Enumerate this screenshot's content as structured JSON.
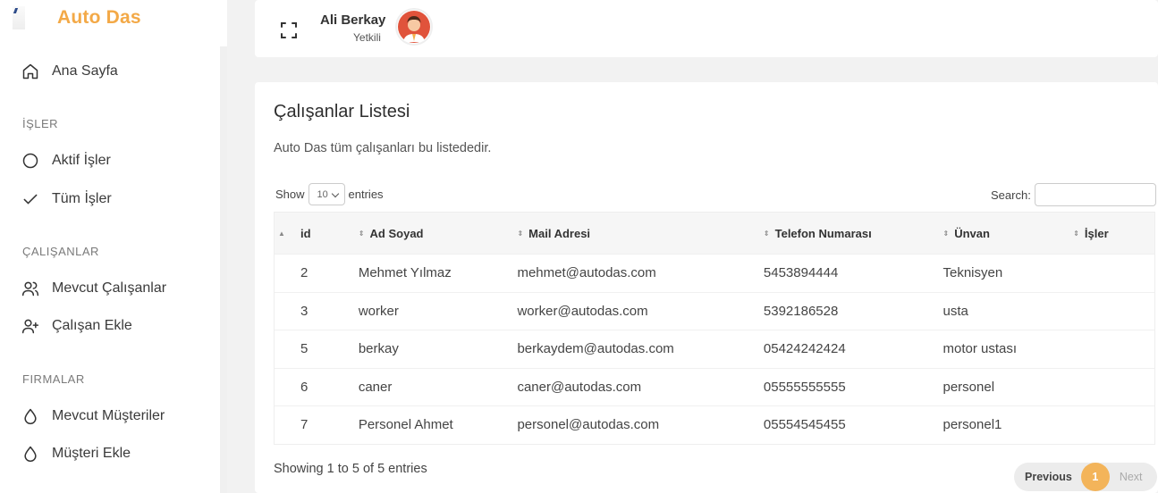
{
  "app": {
    "title": "Auto Das"
  },
  "sidebar": {
    "items": [
      {
        "label": "Ana Sayfa",
        "icon": "home-icon"
      },
      {
        "label": "Aktif İşler",
        "icon": "circle-icon"
      },
      {
        "label": "Tüm İşler",
        "icon": "check-icon"
      },
      {
        "label": "Mevcut Çalışanlar",
        "icon": "users-icon"
      },
      {
        "label": "Çalışan Ekle",
        "icon": "user-plus-icon"
      },
      {
        "label": "Mevcut Müşteriler",
        "icon": "droplet-icon"
      },
      {
        "label": "Müşteri Ekle",
        "icon": "droplet-icon"
      }
    ],
    "sections": [
      "İŞLER",
      "ÇALIŞANLAR",
      "FIRMALAR"
    ]
  },
  "topbar": {
    "user_name": "Ali Berkay",
    "user_role": "Yetkili"
  },
  "card": {
    "title": "Çalışanlar Listesi",
    "description": "Auto Das tüm çalışanları bu listededir."
  },
  "table_controls": {
    "show_label": "Show",
    "page_size": "10",
    "entries_label": "entries",
    "search_label": "Search:"
  },
  "table": {
    "columns": [
      "id",
      "Ad Soyad",
      "Mail Adresi",
      "Telefon Numarası",
      "Ünvan",
      "İşler"
    ],
    "rows": [
      [
        "2",
        "Mehmet Yılmaz",
        "mehmet@autodas.com",
        "5453894444",
        "Teknisyen",
        ""
      ],
      [
        "3",
        "worker",
        "worker@autodas.com",
        "5392186528",
        "usta",
        ""
      ],
      [
        "5",
        "berkay",
        "berkaydem@autodas.com",
        "05424242424",
        "motor ustası",
        ""
      ],
      [
        "6",
        "caner",
        "caner@autodas.com",
        "05555555555",
        "personel",
        ""
      ],
      [
        "7",
        "Personel Ahmet",
        "personel@autodas.com",
        "05554545455",
        "personel1",
        ""
      ]
    ]
  },
  "footer": {
    "info": "Showing 1 to 5 of 5 entries",
    "prev_label": "Previous",
    "current_page": "1",
    "next_label": "Next"
  },
  "colors": {
    "brand": "#f3a947",
    "page_active": "#f3b45a"
  }
}
